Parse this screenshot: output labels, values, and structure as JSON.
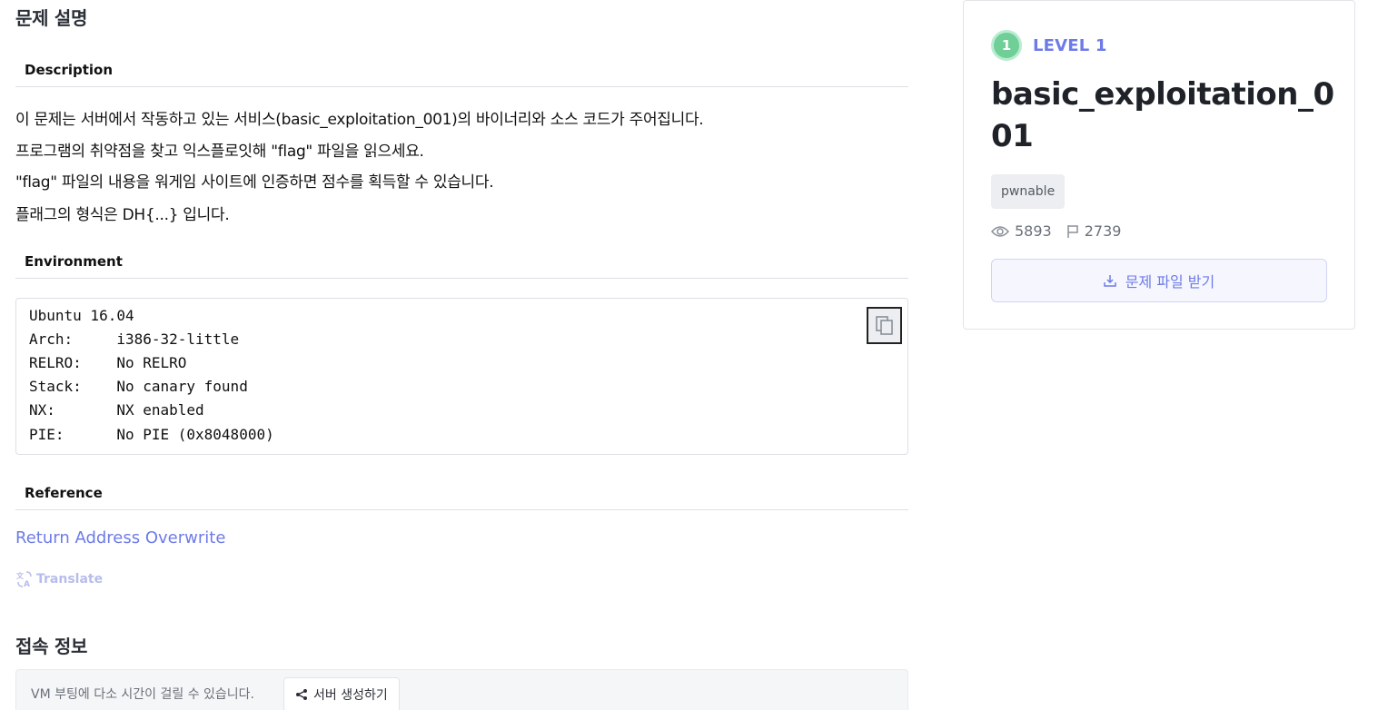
{
  "problem": {
    "title": "문제 설명",
    "description_heading": "Description",
    "description_lines": [
      "이 문제는 서버에서 작동하고 있는 서비스(basic_exploitation_001)의 바이너리와 소스 코드가 주어집니다.",
      "프로그램의 취약점을 찾고 익스플로잇해 \"flag\" 파일을 읽으세요.",
      "\"flag\" 파일의 내용을 워게임 사이트에 인증하면 점수를 획득할 수 있습니다.",
      "플래그의 형식은 DH{...} 입니다."
    ],
    "environment_heading": "Environment",
    "environment_lines": [
      "Ubuntu 16.04",
      "Arch:     i386-32-little",
      "RELRO:    No RELRO",
      "Stack:    No canary found",
      "NX:       NX enabled",
      "PIE:      No PIE (0x8048000)"
    ],
    "copy_icon": "copy-icon",
    "reference_heading": "Reference",
    "reference_link": "Return Address Overwrite",
    "translate_label": "Translate",
    "translate_icon": "translate-icon"
  },
  "connection": {
    "title": "접속 정보",
    "notice": "VM 부팅에 다소 시간이 걸릴 수 있습니다.",
    "create_server_label": "서버 생성하기",
    "share_icon": "share-icon"
  },
  "card": {
    "level_number": "1",
    "level_label": "LEVEL 1",
    "challenge_title": "basic_exploitation_001",
    "tag": "pwnable",
    "views": "5893",
    "solves": "2739",
    "download_label": "문제 파일 받기",
    "colors": {
      "accent": "#6d7be8",
      "level_green": "#6fcf97"
    }
  }
}
